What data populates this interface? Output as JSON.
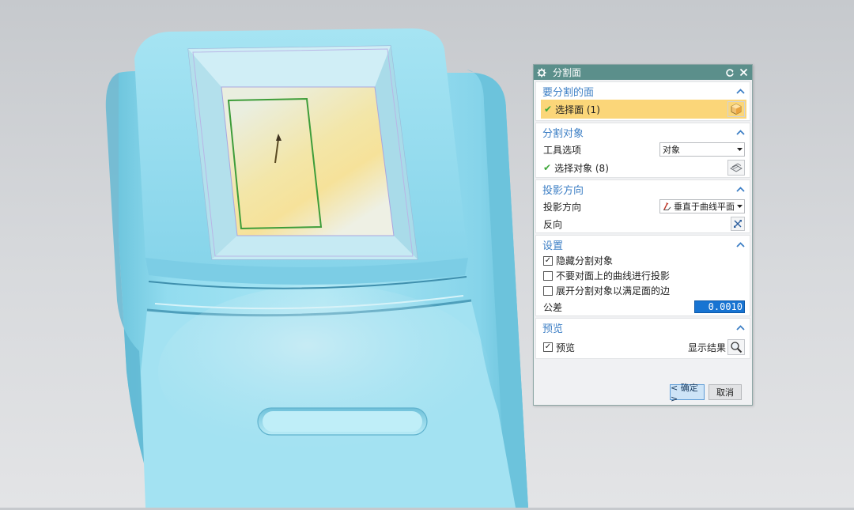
{
  "dialog": {
    "title": "分割面",
    "sections": {
      "face": {
        "title": "要分割的面",
        "select_label": "选择面 (1)"
      },
      "objects": {
        "title": "分割对象",
        "tool_option_label": "工具选项",
        "tool_option_value": "对象",
        "select_label": "选择对象 (8)"
      },
      "projection": {
        "title": "投影方向",
        "direction_label": "投影方向",
        "direction_value": "垂直于曲线平面",
        "reverse_label": "反向"
      },
      "settings": {
        "title": "设置",
        "hide_objects": {
          "label": "隐藏分割对象",
          "checked": true
        },
        "no_project_curves": {
          "label": "不要对面上的曲线进行投影",
          "checked": false
        },
        "expand_objects": {
          "label": "展开分割对象以满足面的边",
          "checked": false
        },
        "tolerance_label": "公差",
        "tolerance_value": "0.0010"
      },
      "preview": {
        "title": "预览",
        "preview_label": "预览",
        "preview_checked": true,
        "show_result_label": "显示结果"
      }
    },
    "buttons": {
      "ok": "< 确定 >",
      "cancel": "取消"
    }
  },
  "colors": {
    "model": "#8cd6eb",
    "titlebar": "#5b8f8b",
    "section_title": "#3d7fc5",
    "selected_row": "#fbd679",
    "tolerance_bg": "#1874d2"
  },
  "icons": [
    "settings-gear-icon",
    "reset-icon",
    "close-icon",
    "collapse-icon",
    "face-select-icon",
    "object-select-icon",
    "dropdown-arrow-icon",
    "projection-icon",
    "reverse-direction-icon",
    "magnifier-icon"
  ]
}
